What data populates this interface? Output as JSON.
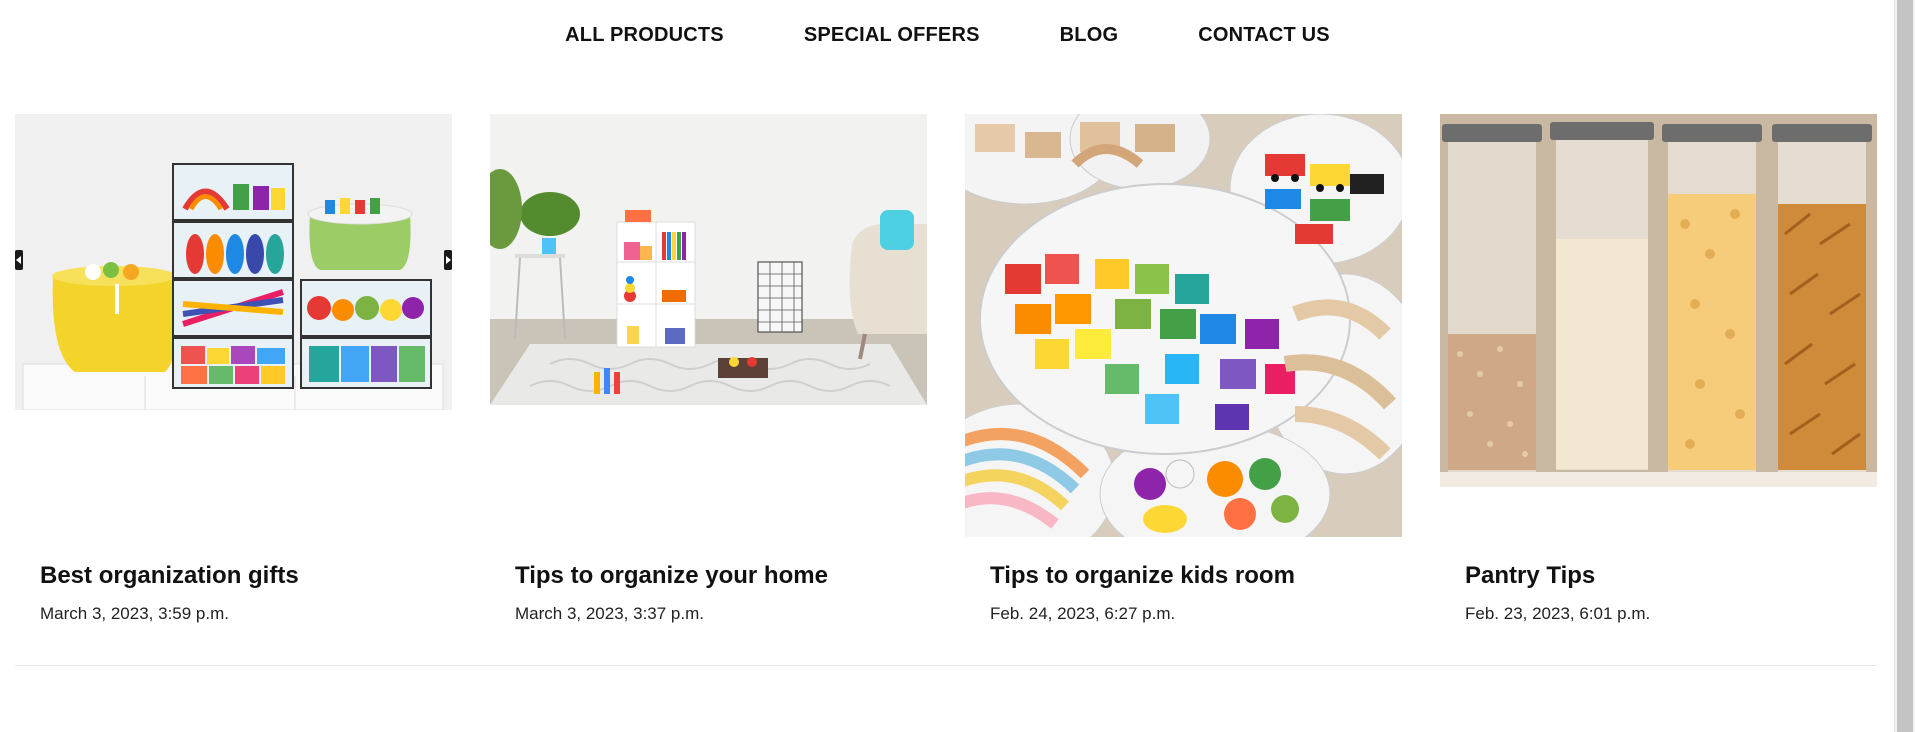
{
  "nav": {
    "items": [
      {
        "label": "ALL PRODUCTS"
      },
      {
        "label": "SPECIAL OFFERS"
      },
      {
        "label": "BLOG"
      },
      {
        "label": "CONTACT US"
      }
    ]
  },
  "posts": [
    {
      "title": "Best organization gifts",
      "date": "March 3, 2023, 3:59 p.m."
    },
    {
      "title": "Tips to organize your home",
      "date": "March 3, 2023, 3:37 p.m."
    },
    {
      "title": "Tips to organize kids room",
      "date": "Feb. 24, 2023, 6:27 p.m."
    },
    {
      "title": "Pantry Tips",
      "date": "Feb. 23, 2023, 6:01 p.m."
    }
  ],
  "icons": {
    "carousel_prev": "chevron-left-icon",
    "carousel_next": "chevron-right-icon"
  }
}
